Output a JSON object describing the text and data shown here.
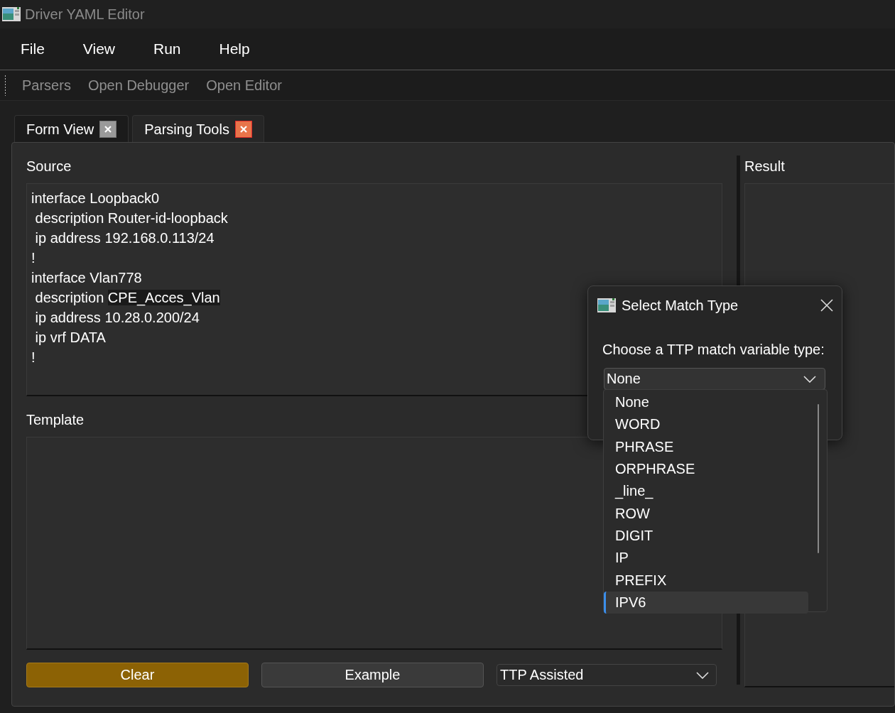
{
  "window": {
    "title": "Driver YAML Editor"
  },
  "menu": [
    "File",
    "View",
    "Run",
    "Help"
  ],
  "toolbar": [
    "Parsers",
    "Open Debugger",
    "Open Editor"
  ],
  "tabs": [
    {
      "label": "Form View",
      "selected": false
    },
    {
      "label": "Parsing Tools",
      "selected": true
    }
  ],
  "source": {
    "label": "Source",
    "lines": [
      {
        "text": "interface Loopback0"
      },
      {
        "text": " description Router-id-loopback"
      },
      {
        "text": " ip address 192.168.0.113/24"
      },
      {
        "text": "!"
      },
      {
        "text": "interface Vlan778"
      },
      {
        "text": " description ",
        "highlighted": "CPE_Acces_Vlan"
      },
      {
        "text": " ip address 10.28.0.200/24"
      },
      {
        "text": " ip vrf DATA"
      },
      {
        "text": "!"
      }
    ]
  },
  "template": {
    "label": "Template"
  },
  "buttons": [
    {
      "label": "Clear",
      "kind": "accent"
    },
    {
      "label": "Example",
      "kind": "plain"
    }
  ],
  "mode_select": {
    "value": "TTP Assisted"
  },
  "result": {
    "label": "Result"
  },
  "dialog": {
    "title": "Select Match Type",
    "prompt": "Choose a TTP match variable type:",
    "combo": {
      "value": "None"
    },
    "options": [
      {
        "label": "None",
        "selected": false
      },
      {
        "label": "WORD",
        "selected": false
      },
      {
        "label": "PHRASE",
        "selected": false
      },
      {
        "label": "ORPHRASE",
        "selected": false
      },
      {
        "label": "_line_",
        "selected": false
      },
      {
        "label": "ROW",
        "selected": false
      },
      {
        "label": "DIGIT",
        "selected": false
      },
      {
        "label": "IP",
        "selected": false
      },
      {
        "label": "PREFIX",
        "selected": false
      },
      {
        "label": "IPV6",
        "selected": true
      }
    ]
  }
}
